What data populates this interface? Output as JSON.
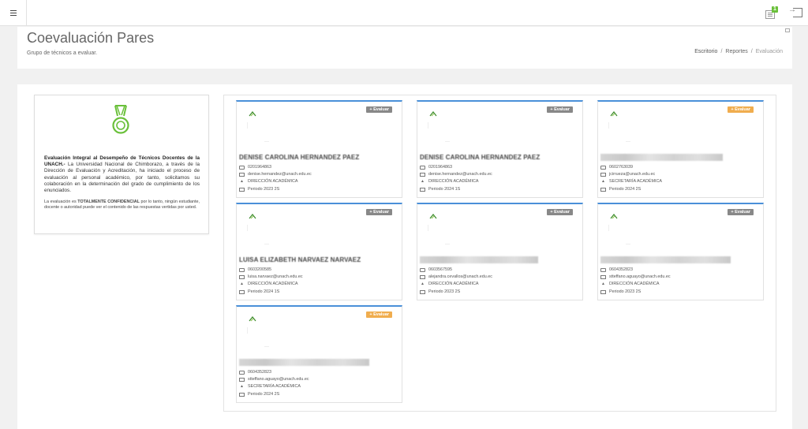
{
  "header": {
    "title": "Coevaluación Pares",
    "subtitle": "Grupo de técnicos a evaluar.",
    "breadcrumb": [
      "Escritorio",
      "Reportes",
      "Evaluación"
    ]
  },
  "topbar": {
    "notification_count": "1"
  },
  "info": {
    "heading": "Evaluación Integral al Desempeño de Técnicos Docentes de la UNACH.-",
    "body": " La Universidad Nacional de Chimborazo, a través de la Dirección de Evaluación y Acreditación, ha iniciado el proceso de evaluación al personal académico, por tanto, solicitamos su colaboración en la determinación del grado de cumplimiento de los enunciados.",
    "note_prefix": "La evaluación es ",
    "note_bold": "TOTALMENTE CONFIDENCIAL",
    "note_suffix": " por lo tanto, ningún estudiante, docente o autoridad puede ver el contenido de las respuestas vertidas por usted."
  },
  "cards": [
    {
      "button": "+ Evaluar",
      "button_color": "gray",
      "name": "DENISE CAROLINA HERNANDEZ PAEZ",
      "phone": "0201964863",
      "email": "denise.hernandez@unach.edu.ec",
      "department": "DIRECCIÓN ACADÉMICA",
      "period": "Periodo 2023 2S"
    },
    {
      "button": "+ Evaluar",
      "button_color": "gray",
      "name": "DENISE CAROLINA HERNANDEZ PAEZ",
      "phone": "0201964863",
      "email": "denise.hernandez@unach.edu.ec",
      "department": "DIRECCIÓN ACADÉMICA",
      "period": "Periodo 2024 1S"
    },
    {
      "button": "+ Evaluar",
      "button_color": "orange",
      "name": "",
      "phone": "0602763039",
      "email": "jcirrueza@unach.edu.ec",
      "department": "SECRETARÍA ACADÉMICA",
      "period": "Periodo 2024 2S"
    },
    {
      "button": "+ Evaluar",
      "button_color": "gray",
      "name": "LUISA ELIZABETH NARVAEZ NARVAEZ",
      "phone": "0603200585",
      "email": "luisa.narvaez@unach.edu.ec",
      "department": "DIRECCIÓN ACADÉMICA",
      "period": "Periodo 2024 1S"
    },
    {
      "button": "+ Evaluar",
      "button_color": "gray",
      "name": "",
      "phone": "0603567595",
      "email": "alejandra.cevallos@unach.edu.ec",
      "department": "DIRECCIÓN ACADÉMICA",
      "period": "Periodo 2023 2S"
    },
    {
      "button": "+ Evaluar",
      "button_color": "gray",
      "name": "",
      "phone": "0604352823",
      "email": "stteffano.aguayo@unach.edu.ec",
      "department": "DIRECCIÓN ACADÉMICA",
      "period": "Periodo 2023 2S"
    },
    {
      "button": "+ Evaluar",
      "button_color": "orange",
      "name": "",
      "phone": "0604352823",
      "email": "stteffano.aguayo@unach.edu.ec",
      "department": "SECRETARÍA ACADÉMICA",
      "period": "Periodo 2024 2S"
    }
  ],
  "colors": {
    "accent": "#4a90d9",
    "success": "#6ac03a",
    "warning": "#f0ad4e"
  }
}
